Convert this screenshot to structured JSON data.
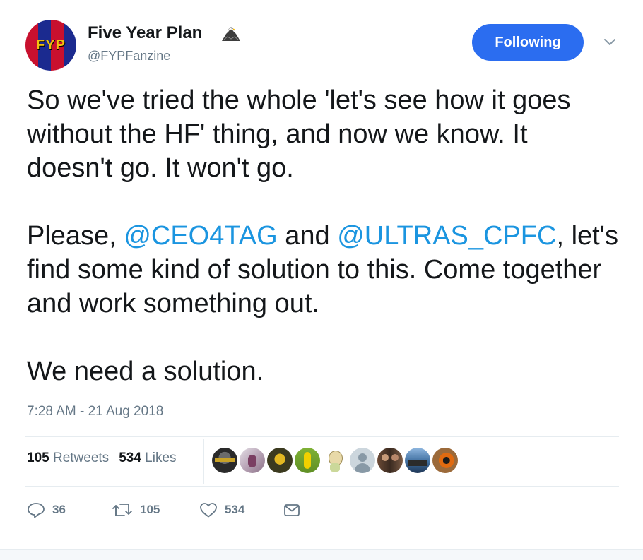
{
  "account": {
    "display_name": "Five Year Plan",
    "handle": "@FYPFanzine",
    "avatar_text": "FYP",
    "badge_icon": "eagle-icon"
  },
  "follow_button": {
    "label": "Following"
  },
  "tweet": {
    "line1": "So we've tried the whole 'let's see how it goes without the HF' thing, and now we know. It doesn't go. It won't go.",
    "para2_prefix": "Please, ",
    "mention1": "@CEO4TAG",
    "para2_and": " and ",
    "mention2": "@ULTRAS_CPFC",
    "para2_suffix": ", let's find some kind of solution to this. Come together and work something out.",
    "line3": "We need a solution.",
    "timestamp": "7:28 AM - 21 Aug 2018"
  },
  "stats": {
    "retweets_count": "105",
    "retweets_label": "Retweets",
    "likes_count": "534",
    "likes_label": "Likes"
  },
  "liker_avatars": [
    "liker-1",
    "liker-2",
    "liker-3",
    "liker-4",
    "liker-5",
    "liker-6",
    "liker-7",
    "liker-8",
    "liker-9"
  ],
  "actions": {
    "reply_count": "36",
    "retweet_count": "105",
    "like_count": "534"
  },
  "colors": {
    "accent_blue": "#2b6df0",
    "link_blue": "#1b95e0",
    "muted_gray": "#657786",
    "text_dark": "#14171a"
  }
}
